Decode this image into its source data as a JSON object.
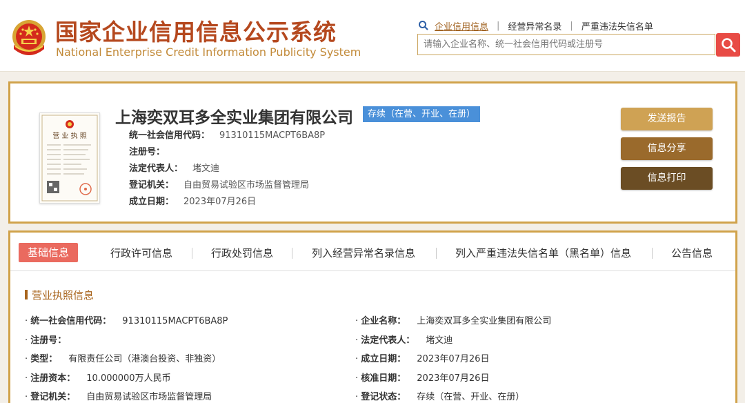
{
  "header": {
    "title_cn": "国家企业信用信息公示系统",
    "title_en": "National Enterprise Credit Information Publicity System",
    "nav": [
      "企业信用信息",
      "经营异常名录",
      "严重违法失信名单"
    ],
    "search_placeholder": "请输入企业名称、统一社会信用代码或注册号"
  },
  "company": {
    "name": "上海奕双耳多全实业集团有限公司",
    "status": "存续（在营、开业、在册）",
    "fields": [
      {
        "label": "统一社会信用代码：",
        "value": "91310115MACPT6BA8P"
      },
      {
        "label": "注册号：",
        "value": ""
      },
      {
        "label": "法定代表人：",
        "value": "堵文迪"
      },
      {
        "label": "登记机关：",
        "value": "自由贸易试验区市场监督管理局"
      },
      {
        "label": "成立日期：",
        "value": "2023年07月26日"
      }
    ],
    "license_title": "营 业 执 照"
  },
  "actions": {
    "send_report": "发送报告",
    "share": "信息分享",
    "print": "信息打印"
  },
  "tabs": [
    "基础信息",
    "行政许可信息",
    "行政处罚信息",
    "列入经营异常名录信息",
    "列入严重违法失信名单（黑名单）信息",
    "公告信息"
  ],
  "section": {
    "title": "营业执照信息",
    "left": [
      {
        "label": "统一社会信用代码：",
        "value": "91310115MACPT6BA8P"
      },
      {
        "label": "注册号：",
        "value": ""
      },
      {
        "label": "类型：",
        "value": "有限责任公司（港澳台投资、非独资）"
      },
      {
        "label": "注册资本：",
        "value": "10.000000万人民币"
      },
      {
        "label": "登记机关：",
        "value": "自由贸易试验区市场监督管理局"
      }
    ],
    "right": [
      {
        "label": "企业名称：",
        "value": "上海奕双耳多全实业集团有限公司"
      },
      {
        "label": "法定代表人：",
        "value": "堵文迪"
      },
      {
        "label": "成立日期：",
        "value": "2023年07月26日"
      },
      {
        "label": "核准日期：",
        "value": "2023年07月26日"
      },
      {
        "label": "登记状态：",
        "value": "存续（在营、开业、在册）"
      }
    ]
  },
  "colors": {
    "brand_red": "#b5481e",
    "brand_gold": "#c28a39",
    "card_border": "#d0a24a",
    "status_blue": "#4a90d9",
    "active_tab": "#ea6a5f",
    "search_red": "#e84b45"
  }
}
